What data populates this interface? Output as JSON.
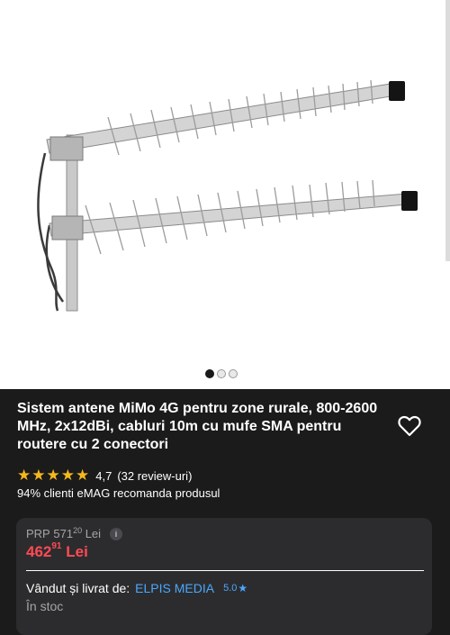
{
  "product": {
    "title": "Sistem antene MiMo 4G pentru zone rurale, 800-2600 MHz, 2x12dBi, cabluri 10m cu mufe SMA pentru routere cu 2 conectori",
    "rating": "4,7",
    "reviews": "(32 review-uri)",
    "stars": 5,
    "recommend": "94% clienti eMAG recomanda produsul",
    "gallery": {
      "count": 3,
      "active_index": 0
    }
  },
  "pricing": {
    "prp_label": "PRP",
    "prp_int": "571",
    "prp_dec": "20",
    "prp_currency": "Lei",
    "price_int": "462",
    "price_dec": "91",
    "price_currency": "Lei"
  },
  "seller": {
    "label": "Vândut și livrat de:",
    "name": "ELPIS MEDIA",
    "rating": "5.0",
    "stock": "În stoc"
  },
  "colors": {
    "background": "#1b1b1b",
    "price": "#ff4b55",
    "link": "#4aa8ff",
    "star": "#f6b81e"
  },
  "icons": [
    "heart-icon",
    "star-icon",
    "info-icon"
  ]
}
